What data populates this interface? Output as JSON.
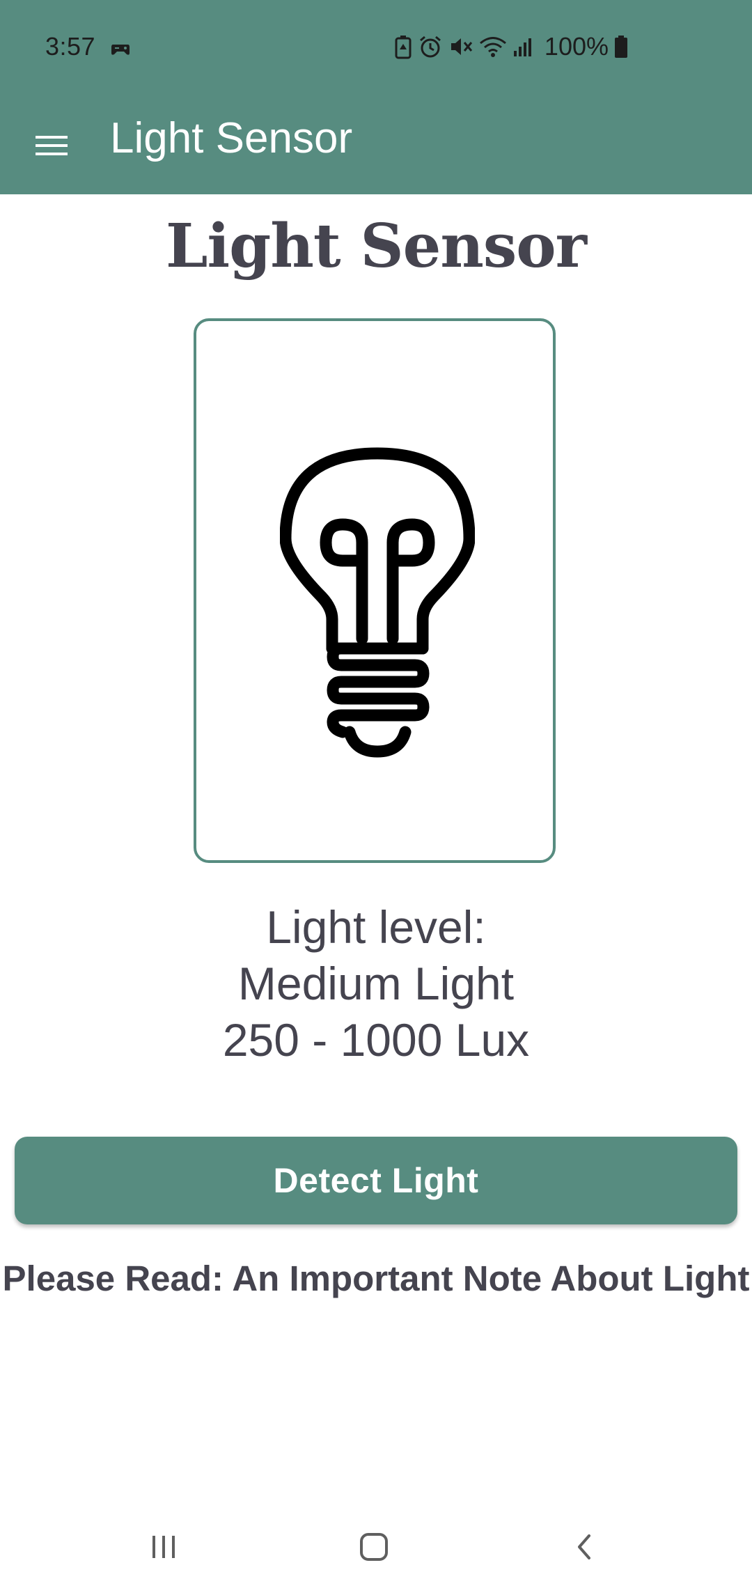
{
  "status_bar": {
    "time": "3:57",
    "battery": "100%",
    "icons": [
      "game-controller-icon",
      "battery-saver-icon",
      "alarm-icon",
      "mute-icon",
      "wifi-icon",
      "signal-icon",
      "battery-icon"
    ]
  },
  "toolbar": {
    "menu_icon": "hamburger-menu-icon",
    "title": "Light Sensor"
  },
  "main": {
    "heading": "Light Sensor",
    "bulb_icon": "light-bulb-icon",
    "level_label": "Light level:",
    "level_name": "Medium Light",
    "level_range": "250 - 1000 Lux",
    "detect_button": "Detect Light",
    "note_link": "Please Read: An Important Note About Light"
  },
  "nav_bar": {
    "recents_icon": "recents-icon",
    "home_icon": "home-icon",
    "back_icon": "back-icon"
  },
  "colors": {
    "primary": "#578c80",
    "text": "#45444f",
    "background": "#ffffff"
  }
}
